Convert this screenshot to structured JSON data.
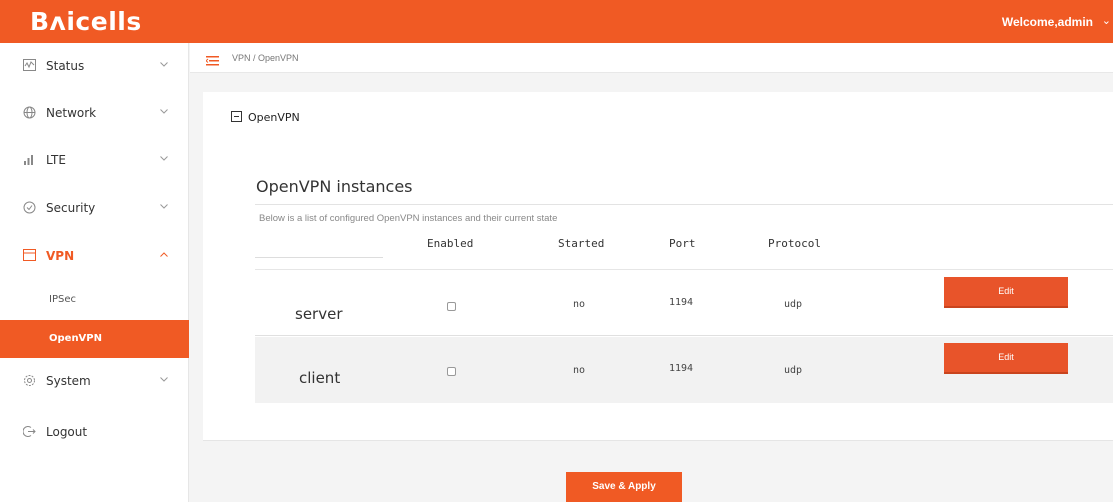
{
  "header": {
    "logo_text": "Bᴧicells",
    "welcome_text": "Welcome,admin",
    "brand_color": "#f05a24"
  },
  "sidebar": {
    "items": [
      {
        "label": "Status",
        "icon": "status-icon"
      },
      {
        "label": "Network",
        "icon": "globe-icon"
      },
      {
        "label": "LTE",
        "icon": "signal-icon"
      },
      {
        "label": "Security",
        "icon": "shield-icon"
      },
      {
        "label": "VPN",
        "icon": "vpn-icon",
        "active": true
      },
      {
        "label": "System",
        "icon": "gear-icon"
      },
      {
        "label": "Logout",
        "icon": "logout-icon"
      }
    ],
    "vpn_sub": [
      {
        "label": "IPSec"
      },
      {
        "label": "OpenVPN",
        "selected": true
      }
    ]
  },
  "breadcrumb": {
    "text": "VPN / OpenVPN"
  },
  "section": {
    "title": "OpenVPN",
    "instances_title": "OpenVPN instances",
    "instances_desc": "Below is a list of configured OpenVPN instances and their current state"
  },
  "table": {
    "headers": {
      "enabled": "Enabled",
      "started": "Started",
      "port": "Port",
      "protocol": "Protocol"
    },
    "rows": [
      {
        "name": "server",
        "enabled": false,
        "started": "no",
        "port": "1194",
        "protocol": "udp",
        "action": "Edit"
      },
      {
        "name": "client",
        "enabled": false,
        "started": "no",
        "port": "1194",
        "protocol": "udp",
        "action": "Edit"
      }
    ]
  },
  "footer": {
    "save_label": "Save & Apply"
  }
}
